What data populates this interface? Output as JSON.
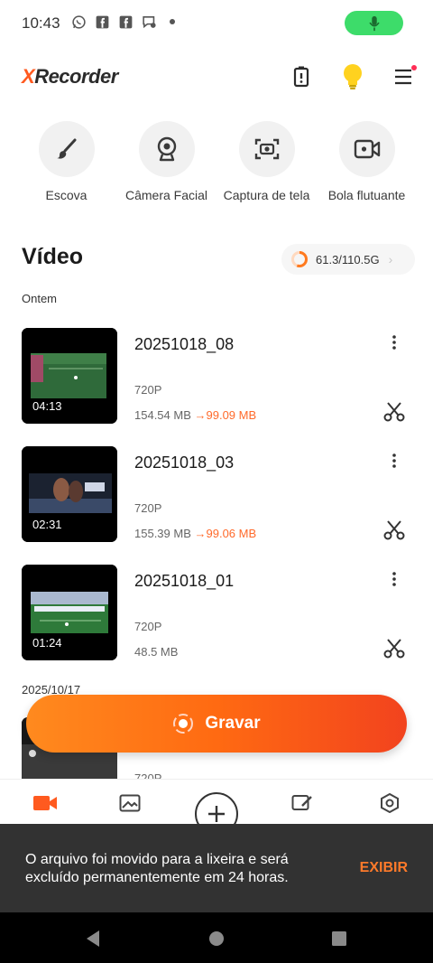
{
  "status_bar": {
    "time": "10:43",
    "icons": [
      "whatsapp-icon",
      "facebook-icon",
      "facebook-icon",
      "chat-icon",
      "dot-icon"
    ],
    "mic_color": "#3ddc6a"
  },
  "header": {
    "logo_x": "X",
    "logo_rest": "Recorder",
    "accent": "#ff5a1f"
  },
  "tools": [
    {
      "label": "Escova",
      "icon": "brush-icon"
    },
    {
      "label": "Câmera Facial",
      "icon": "webcam-icon"
    },
    {
      "label": "Captura de tela",
      "icon": "screenshot-icon"
    },
    {
      "label": "Bola flutuante",
      "icon": "floating-video-icon"
    }
  ],
  "section": {
    "title": "Vídeo",
    "storage": "61.3/110.5G",
    "storage_used_fraction": 0.555
  },
  "groups": {
    "yesterday": "Ontem",
    "older": "2025/10/17"
  },
  "videos": [
    {
      "name": "20251018_08",
      "duration": "04:13",
      "resolution": "720P",
      "size": "154.54 MB",
      "arrow": "→",
      "new_size": "99.09 MB"
    },
    {
      "name": "20251018_03",
      "duration": "02:31",
      "resolution": "720P",
      "size": "155.39 MB",
      "arrow": "→",
      "new_size": "99.06 MB"
    },
    {
      "name": "20251018_01",
      "duration": "01:24",
      "resolution": "720P",
      "size": "48.5 MB",
      "arrow": "",
      "new_size": ""
    },
    {
      "name": "",
      "duration": "",
      "resolution": "720P",
      "size": "",
      "arrow": "",
      "new_size": ""
    }
  ],
  "record": {
    "label": "Gravar"
  },
  "snackbar": {
    "message": "O arquivo foi movido para a lixeira e será excluído permanentemente em 24 horas.",
    "action": "EXIBIR"
  }
}
